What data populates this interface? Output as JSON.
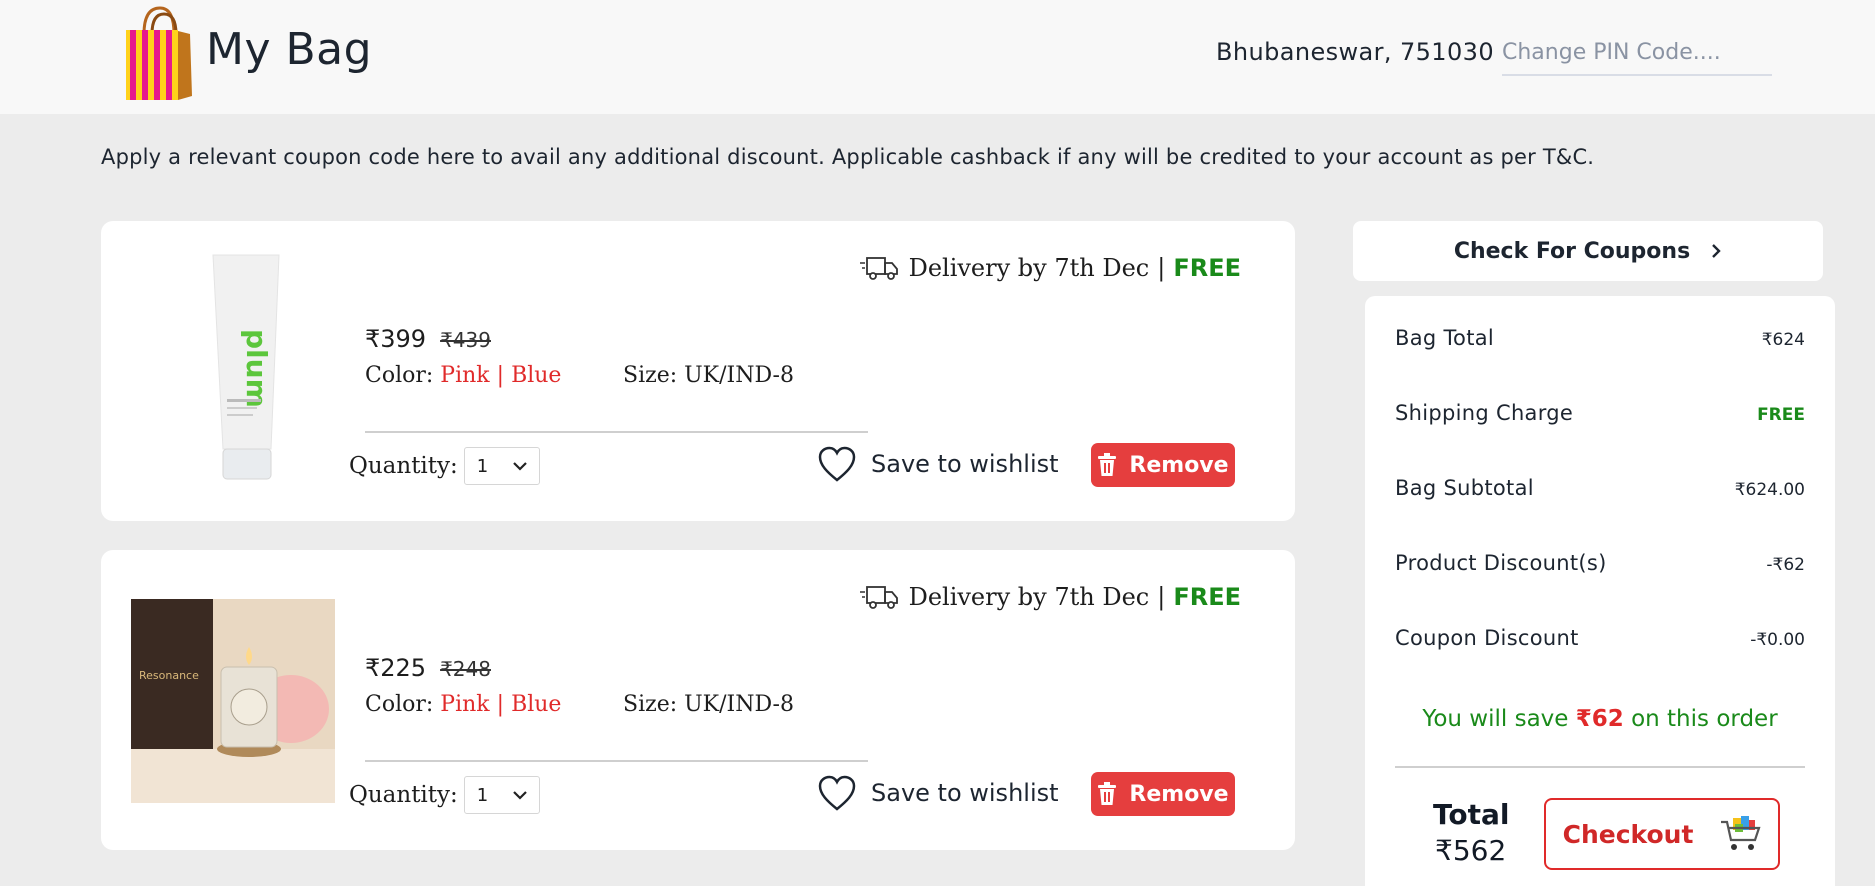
{
  "header": {
    "title": "My Bag",
    "location": "Bhubaneswar, 751030",
    "pin_placeholder": "Change PIN Code...."
  },
  "coupon_note": "Apply a relevant coupon code here to avail any additional discount. Applicable cashback if any will be credited to your account as per T&C.",
  "items": [
    {
      "image": "plum-tube-product-image",
      "delivery_text": "Delivery by 7th Dec",
      "delivery_sep": "|",
      "delivery_fee": "FREE",
      "price": "₹399",
      "mrp": "₹439",
      "color_label": "Color:",
      "color_a": "Pink",
      "color_sep": "|",
      "color_b": "Blue",
      "size_label": "Size:",
      "size_value": "UK/IND-8",
      "qty_label": "Quantity:",
      "qty_value": "1",
      "wishlist_label": "Save to wishlist",
      "remove_label": "Remove"
    },
    {
      "image": "resonance-candle-product-image",
      "delivery_text": "Delivery by 7th Dec",
      "delivery_sep": "|",
      "delivery_fee": "FREE",
      "price": "₹225",
      "mrp": "₹248",
      "color_label": "Color:",
      "color_a": "Pink",
      "color_sep": "|",
      "color_b": "Blue",
      "size_label": "Size:",
      "size_value": "UK/IND-8",
      "qty_label": "Quantity:",
      "qty_value": "1",
      "wishlist_label": "Save to wishlist",
      "remove_label": "Remove"
    }
  ],
  "coupons_button": "Check For Coupons",
  "summary": {
    "rows": [
      {
        "label": "Bag Total",
        "value": "₹624"
      },
      {
        "label": "Shipping Charge",
        "value": "FREE"
      },
      {
        "label": "Bag Subtotal",
        "value": "₹624.00"
      },
      {
        "label": "Product Discount(s)",
        "value": "-₹62"
      },
      {
        "label": "Coupon Discount",
        "value": "-₹0.00"
      }
    ],
    "save_prefix": "You will save",
    "save_amount": "₹62",
    "save_suffix": "on this order",
    "total_label": "Total",
    "total_value": "₹562",
    "checkout_label": "Checkout"
  },
  "colors": {
    "accent_red": "#e53e3e",
    "free_green": "#1a8a1a",
    "page_bg": "#ececec"
  }
}
